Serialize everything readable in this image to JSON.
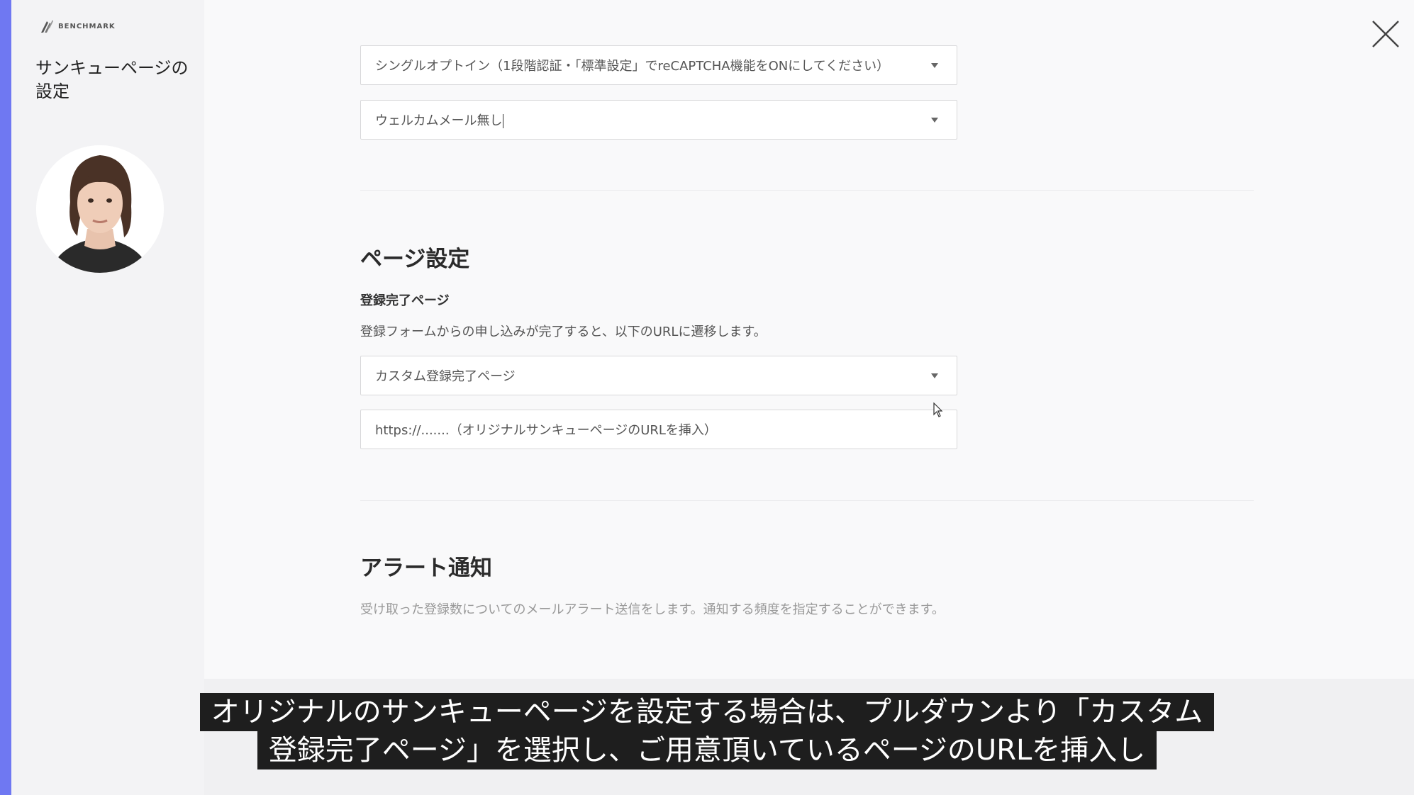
{
  "brand": {
    "logo_text": "BENCHMARK"
  },
  "sidebar": {
    "title": "サンキューページの設定"
  },
  "form": {
    "optin_select": "シングルオプトイン（1段階認証・「標準設定」でreCAPTCHA機能をONにしてください）",
    "welcome_select": "ウェルカムメール無し",
    "page_settings": {
      "heading": "ページ設定",
      "completion_label": "登録完了ページ",
      "completion_desc": "登録フォームからの申し込みが完了すると、以下のURLに遷移します。",
      "completion_select": "カスタム登録完了ページ",
      "url_input": "https://.......（オリジナルサンキューページのURLを挿入）"
    },
    "alert": {
      "heading": "アラート通知",
      "desc": "受け取った登録数についてのメールアラート送信をします。通知する頻度を指定することができます。"
    }
  },
  "subtitles": {
    "line1": "オリジナルのサンキューページを設定する場合は、プルダウンより「カスタム",
    "line2": "登録完了ページ」を選択し、ご用意頂いているページのURLを挿入し"
  },
  "colors": {
    "accent": "#6f78f2",
    "subtitle_bg": "#1e1e1e"
  },
  "icons": {
    "logo": "benchmark-logo-icon",
    "close": "close-icon",
    "dropdown": "chevron-down-icon",
    "cursor": "mouse-pointer-icon"
  }
}
